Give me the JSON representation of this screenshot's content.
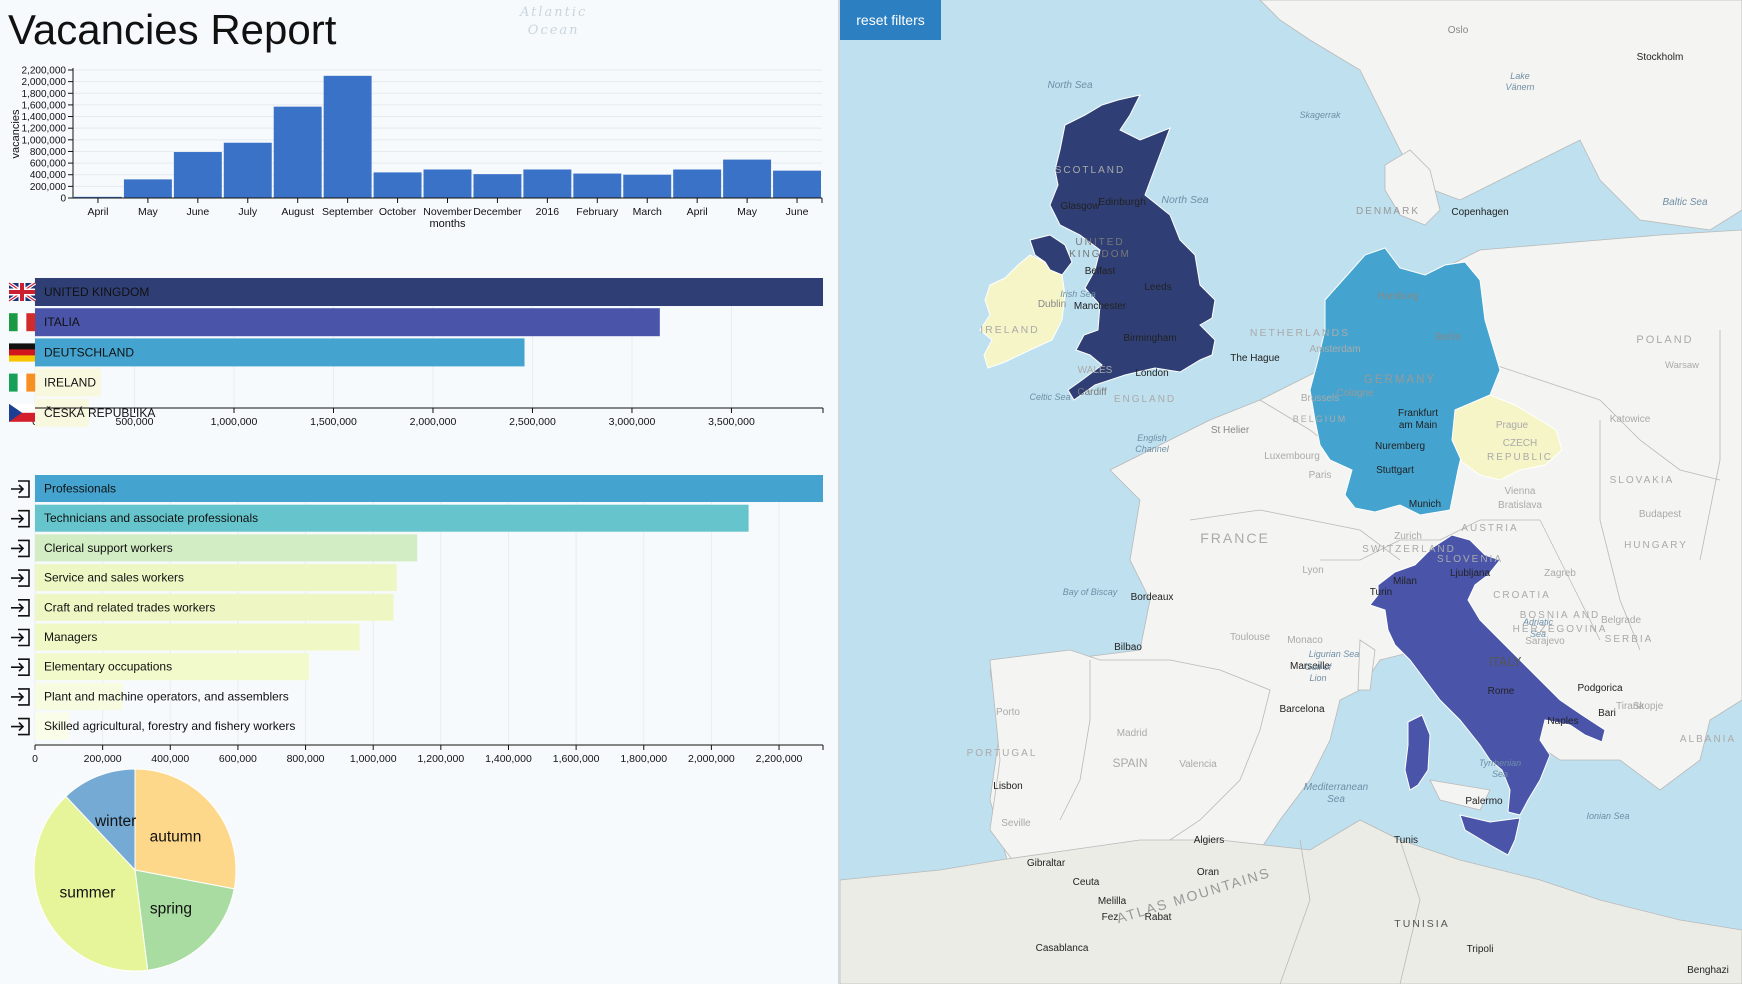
{
  "title": "Vacancies Report",
  "reset_filters_label": "reset filters",
  "colors": {
    "bar": "#3a72c8",
    "uk": "#2f3f75",
    "it": "#4a55aa",
    "de": "#44a4cf",
    "ie": "#f6f5c8",
    "cz": "#f6f5c8"
  },
  "watermark": {
    "line1": "Atlantic",
    "line2": "Ocean"
  },
  "chart_data": [
    {
      "type": "bar",
      "categories": [
        "April",
        "May",
        "June",
        "July",
        "August",
        "September",
        "October",
        "November",
        "December",
        "2016",
        "February",
        "March",
        "April",
        "May",
        "June"
      ],
      "values": [
        20000,
        320000,
        790000,
        950000,
        1570000,
        2100000,
        440000,
        490000,
        410000,
        490000,
        420000,
        400000,
        490000,
        660000,
        470000
      ],
      "ylabel": "vacancies",
      "xlabel": "months",
      "ylim": [
        0,
        2200000
      ],
      "yticks": [
        0,
        200000,
        400000,
        600000,
        800000,
        1000000,
        1200000,
        1400000,
        1600000,
        1800000,
        2000000,
        2200000
      ],
      "ytick_labels": [
        "0",
        "200,000",
        "400,000",
        "600,000",
        "800,000",
        "1,000,000",
        "1,200,000",
        "1,400,000",
        "1,600,000",
        "1,800,000",
        "2,000,000",
        "2,200,000"
      ]
    },
    {
      "type": "bar",
      "orientation": "horizontal",
      "categories": [
        "UNITED KINGDOM",
        "ITALIA",
        "DEUTSCHLAND",
        "IRELAND",
        "ČESKÁ REPUBLIKA"
      ],
      "values": [
        3960000,
        3140000,
        2460000,
        330000,
        270000
      ],
      "flags": [
        "uk",
        "it",
        "de",
        "ie",
        "cz"
      ],
      "bar_colors": [
        "#2f3f75",
        "#4a55aa",
        "#44a4cf",
        "#f8f8df",
        "#f8f8df"
      ],
      "xlim": [
        0,
        3960000
      ],
      "xticks": [
        0,
        500000,
        1000000,
        1500000,
        2000000,
        2500000,
        3000000,
        3500000
      ],
      "xtick_labels": [
        "0",
        "500,000",
        "1,000,000",
        "1,500,000",
        "2,000,000",
        "2,500,000",
        "3,000,000",
        "3,500,000"
      ]
    },
    {
      "type": "bar",
      "orientation": "horizontal",
      "categories": [
        "Professionals",
        "Technicians and associate professionals",
        "Clerical support workers",
        "Service and sales workers",
        "Craft and related trades workers",
        "Managers",
        "Elementary occupations",
        "Plant and machine operators, and assemblers",
        "Skilled agricultural, forestry and fishery workers"
      ],
      "values": [
        2330000,
        2110000,
        1130000,
        1070000,
        1060000,
        960000,
        810000,
        260000,
        100000
      ],
      "bar_colors": [
        "#44a4cf",
        "#66c4cc",
        "#d2ecc4",
        "#edf7c4",
        "#eef7c4",
        "#f0f8c6",
        "#f2f9ca",
        "#f7fbe0",
        "#fafde8"
      ],
      "xlim": [
        0,
        2330000
      ],
      "xticks": [
        0,
        200000,
        400000,
        600000,
        800000,
        1000000,
        1200000,
        1400000,
        1600000,
        1800000,
        2000000,
        2200000
      ],
      "xtick_labels": [
        "0",
        "200,000",
        "400,000",
        "600,000",
        "800,000",
        "1,000,000",
        "1,200,000",
        "1,400,000",
        "1,600,000",
        "1,800,000",
        "2,000,000",
        "2,200,000"
      ]
    },
    {
      "type": "pie",
      "labels": [
        "autumn",
        "spring",
        "summer",
        "winter"
      ],
      "values": [
        28,
        20,
        40,
        12
      ],
      "colors": [
        "#fdd88a",
        "#a9dca0",
        "#e6f59a",
        "#74aad4"
      ]
    }
  ],
  "map": {
    "place_labels": [
      "North Sea",
      "North Sea",
      "Skagerrak",
      "Baltic Sea",
      "Oslo",
      "Stockholm",
      "DENMARK",
      "Copenhagen",
      "SCOTLAND",
      "Glasgow",
      "Edinburgh",
      "UNITED",
      "KINGDOM",
      "Belfast",
      "Irish Sea",
      "Dublin",
      "Manchester",
      "Leeds",
      "IRELAND",
      "Birmingham",
      "WALES",
      "London",
      "Cardiff",
      "ENGLAND",
      "Celtic Sea",
      "English",
      "Channel",
      "NETHERLANDS",
      "The Hague",
      "Amsterdam",
      "Hamburg",
      "Berlin",
      "POLAND",
      "Warsaw",
      "GERMANY",
      "Cologne",
      "Brussels",
      "BELGIUM",
      "Frankfurt",
      "am Main",
      "Prague",
      "CZECH",
      "REPUBLIC",
      "Katowice",
      "Luxembourg",
      "Paris",
      "Nuremberg",
      "Stuttgart",
      "Munich",
      "Vienna",
      "Bratislava",
      "SLOVAKIA",
      "Budapest",
      "HUNGARY",
      "St Helier",
      "FRANCE",
      "AUSTRIA",
      "Zurich",
      "SWITZERLAND",
      "Lyon",
      "Milan",
      "Turin",
      "Ljubljana",
      "SLOVENIA",
      "Zagreb",
      "CROATIA",
      "BOSNIA AND",
      "HERZEGOVINA",
      "Sarajevo",
      "Belgrade",
      "SERBIA",
      "Bay of Biscay",
      "Bordeaux",
      "Toulouse",
      "Monaco",
      "Marseille",
      "Ligurian Sea",
      "Adriatic",
      "Sea",
      "ITALY",
      "Bilbao",
      "Gulf of",
      "Lion",
      "Barcelona",
      "Rome",
      "Podgorica",
      "Tirana",
      "Skopje",
      "Bari",
      "Naples",
      "Porto",
      "Madrid",
      "PORTUGAL",
      "SPAIN",
      "Valencia",
      "Lisbon",
      "Seville",
      "Mediterranean",
      "Sea",
      "Tyrrhenian",
      "Sea",
      "Palermo",
      "Ionian Sea",
      "ALBANIA",
      "Gibraltar",
      "Algiers",
      "Tunis",
      "Ceuta",
      "Melilla",
      "Oran",
      "Rabat",
      "Fez",
      "Casablanca",
      "ATLAS MOUNTAINS",
      "TUNISIA",
      "Tripoli",
      "Benghazi",
      "Lake",
      "Vänern"
    ]
  }
}
